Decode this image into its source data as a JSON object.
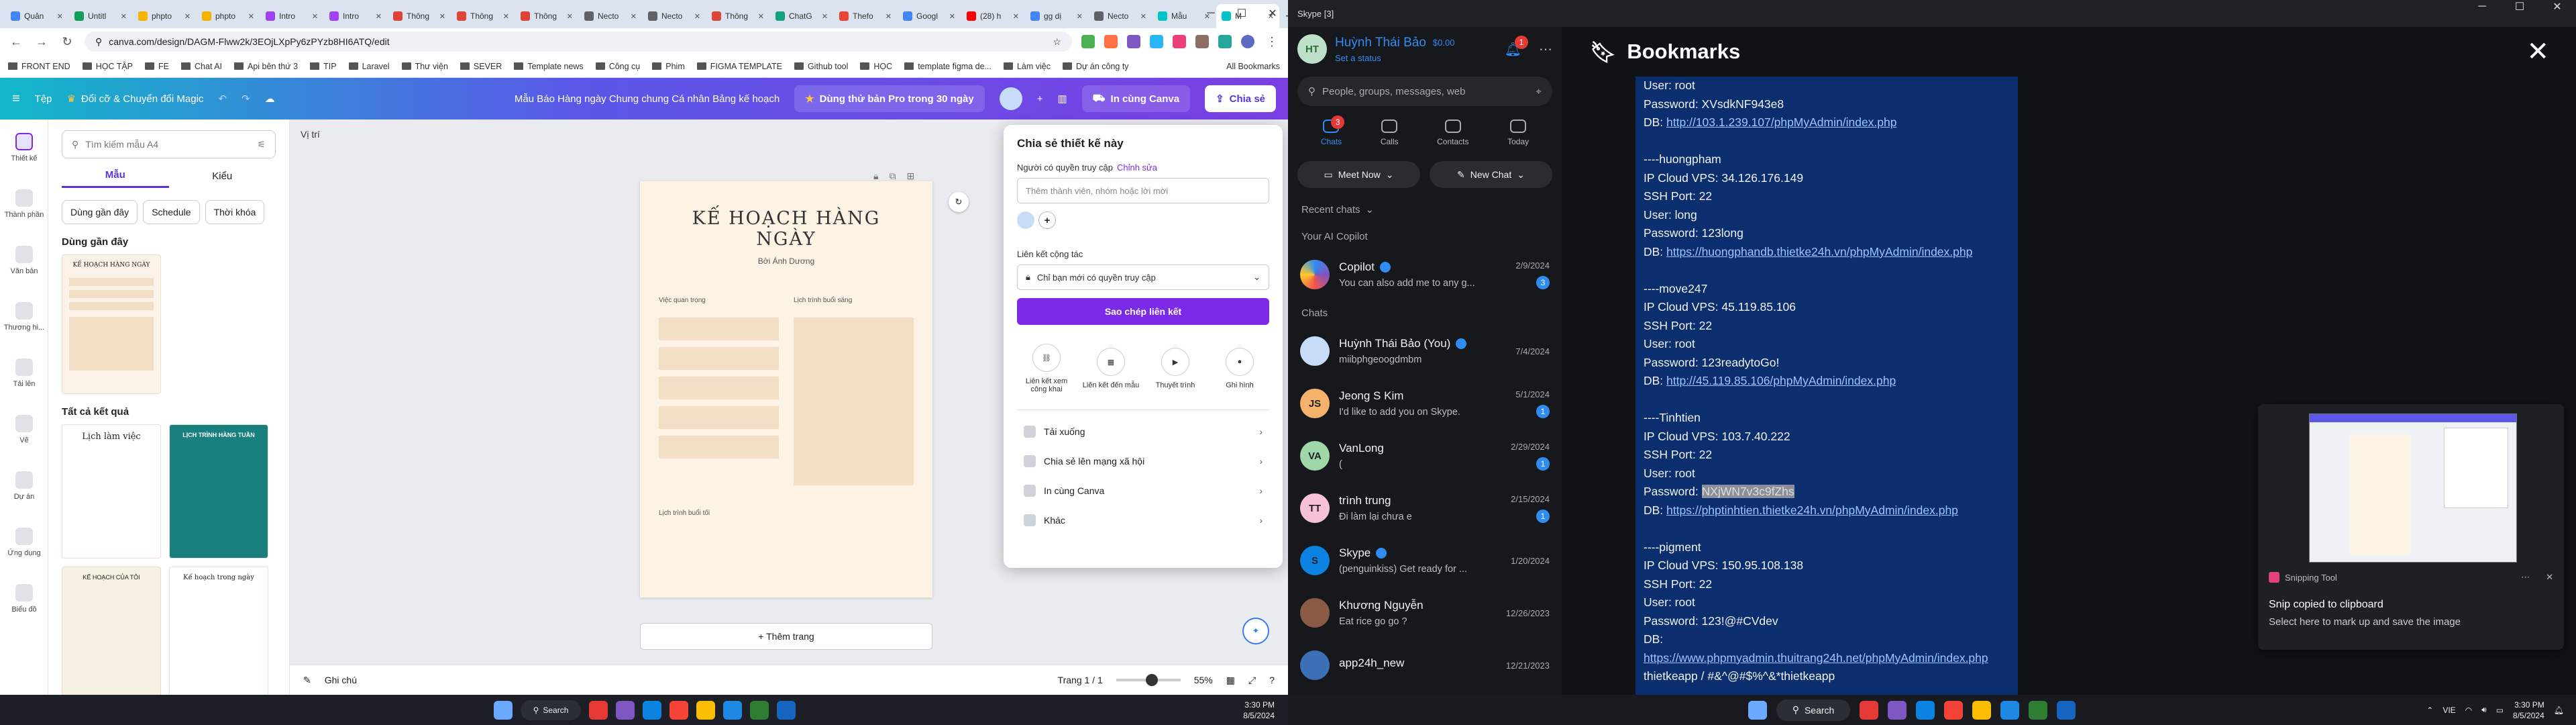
{
  "chrome": {
    "tabs": [
      {
        "label": "Quản",
        "color": "#4285f4"
      },
      {
        "label": "Untitl",
        "color": "#0f9d58"
      },
      {
        "label": "phpto",
        "color": "#f4b400"
      },
      {
        "label": "phpto",
        "color": "#f4b400"
      },
      {
        "label": "Intro",
        "color": "#a142f4"
      },
      {
        "label": "Intro",
        "color": "#a142f4"
      },
      {
        "label": "Thông",
        "color": "#db4437"
      },
      {
        "label": "Thông",
        "color": "#db4437"
      },
      {
        "label": "Thông",
        "color": "#db4437"
      },
      {
        "label": "Necto",
        "color": "#5f6368"
      },
      {
        "label": "Necto",
        "color": "#5f6368"
      },
      {
        "label": "Thông",
        "color": "#db4437"
      },
      {
        "label": "ChatG",
        "color": "#10a37f"
      },
      {
        "label": "Thefo",
        "color": "#ea4335"
      },
      {
        "label": "Googl",
        "color": "#4285f4"
      },
      {
        "label": "(28) h",
        "color": "#ff0000"
      },
      {
        "label": "gg dị",
        "color": "#4285f4"
      },
      {
        "label": "Necto",
        "color": "#5f6368"
      },
      {
        "label": "Mẫu",
        "color": "#00c4cc"
      },
      {
        "label": "M",
        "color": "#00c4cc",
        "active": true
      }
    ],
    "url": "canva.com/design/DAGM-Flww2k/3EOjLXpPy6zPYzb8HI6ATQ/edit",
    "bookmarks": [
      "FRONT END",
      "HỌC TẬP",
      "FE",
      "Chat AI",
      "Api bên thứ 3",
      "TIP",
      "Laravel",
      "Thư viện",
      "SEVER",
      "Template news",
      "Công cụ",
      "Phim",
      "FIGMA TEMPLATE",
      "Github tool",
      "HỌC",
      "template figma de...",
      "Làm việc",
      "Dự án công ty"
    ],
    "all_bookmarks": "All Bookmarks"
  },
  "canva": {
    "menu_file": "Tệp",
    "resize": "Đổi cỡ & Chuyển đổi Magic",
    "doc_title": "Mẫu Báo Hàng ngày Chung chung Cá nhân Bảng kế hoạch",
    "pro_trial": "Dùng thử bản Pro trong 30 ngày",
    "print": "In cùng Canva",
    "share": "Chia sẻ",
    "sidebar": [
      "Thiết kế",
      "Thành phần",
      "Văn bản",
      "Thương hi...",
      "Tải lên",
      "Vẽ",
      "Dự án",
      "Ứng dụng",
      "Biểu đồ"
    ],
    "search_placeholder": "Tìm kiếm mẫu A4",
    "tab_templates": "Mẫu",
    "tab_styles": "Kiểu",
    "chips": [
      "Dùng gần đây",
      "Schedule",
      "Thời khóa"
    ],
    "recent_heading": "Dùng gần đây",
    "all_results": "Tất cả kết quả",
    "thumb_titles": [
      "Lịch làm việc",
      "LỊCH TRÌNH HÀNG TUẦN",
      "KẾ HOẠCH CỦA TÔI",
      "Kế hoạch trong ngày"
    ],
    "position": "Vị trí",
    "page_title": "KẾ HOẠCH HÀNG NGÀY",
    "page_author": "Bởi Ánh Dương",
    "col_tasks": "Việc quan trọng",
    "col_morning": "Lịch trình buổi sáng",
    "col_evening": "Lịch trình buổi tối",
    "add_page": "+ Thêm trang",
    "notes": "Ghi chú",
    "page_count": "Trang 1 / 1",
    "zoom": "55%",
    "zoom_level": 0.55
  },
  "share_panel": {
    "title": "Chia sẻ thiết kế này",
    "access_label": "Người có quyền truy cập",
    "edit_link": "Chỉnh sửa",
    "invite_placeholder": "Thêm thành viên, nhóm hoặc lời mời",
    "collab_label": "Liên kết cộng tác",
    "access_option": "Chỉ bạn mới có quyền truy cập",
    "copy_link": "Sao chép liên kết",
    "icons": [
      "Liên kết xem công khai",
      "Liên kết đến mẫu",
      "Thuyết trình",
      "Ghi hình"
    ],
    "rows": [
      "Tải xuống",
      "Chia sẻ lên mạng xã hội",
      "In cùng Canva",
      "Khác"
    ]
  },
  "skype": {
    "window_title": "Skype [3]",
    "user": "Huỳnh Thái Bảo",
    "initials": "HT",
    "balance": "$0.00",
    "status": "Set a status",
    "notif": "1",
    "search_placeholder": "People, groups, messages, web",
    "nav": [
      {
        "label": "Chats",
        "badge": "3"
      },
      {
        "label": "Calls"
      },
      {
        "label": "Contacts"
      },
      {
        "label": "Today"
      }
    ],
    "meet_now": "Meet Now",
    "new_chat": "New Chat",
    "recent": "Recent chats",
    "copilot_heading": "Your AI Copilot",
    "chats_heading": "Chats",
    "copilot": {
      "name": "Copilot",
      "msg": "You can also add me to any g...",
      "date": "2/9/2024",
      "badge": "3"
    },
    "chats": [
      {
        "name": "Huỳnh Thái Bảo (You)",
        "msg": "miibphgeoogdmbm",
        "date": "7/4/2024",
        "initials": "",
        "color": "#c7ddf7",
        "verified": true
      },
      {
        "name": "Jeong S Kim",
        "msg": "I'd like to add you on Skype.",
        "date": "5/1/2024",
        "initials": "JS",
        "color": "#f4b26b",
        "badge": "1"
      },
      {
        "name": "VanLong",
        "msg": "(",
        "date": "2/29/2024",
        "initials": "VA",
        "color": "#9fd7a9",
        "badge": "1"
      },
      {
        "name": "trình trung",
        "msg": "Đi làm lại chưa e",
        "date": "2/15/2024",
        "initials": "TT",
        "color": "#f7c1d9",
        "badge": "1"
      },
      {
        "name": "Skype",
        "msg": "(penguinkiss) Get ready for ...",
        "date": "1/20/2024",
        "initials": "S",
        "color": "#0a84e0",
        "verified": true
      },
      {
        "name": "Khương Nguyễn",
        "msg": "Eat rice go go ?",
        "date": "12/26/2023",
        "initials": "",
        "color": "#8a5a44"
      },
      {
        "name": "app24h_new",
        "msg": "",
        "date": "12/21/2023",
        "initials": "",
        "color": "#3b6fb6"
      }
    ],
    "bookmarks_title": "Bookmarks",
    "doc_lines": [
      {
        "t": "User: root"
      },
      {
        "t": "Password: XVsdkNF943e8"
      },
      {
        "t": "DB: ",
        "link": "http://103.1.239.107/phpMyAdmin/index.php"
      },
      {
        "t": ""
      },
      {
        "t": "----huongpham"
      },
      {
        "t": "IP Cloud VPS: 34.126.176.149"
      },
      {
        "t": "SSH Port: 22"
      },
      {
        "t": "User: long"
      },
      {
        "t": "Password: 123long"
      },
      {
        "t": "DB: ",
        "link": "https://huongphandb.thietke24h.vn/phpMyAdmin/index.php"
      },
      {
        "t": ""
      },
      {
        "t": "----move247"
      },
      {
        "t": "IP Cloud VPS: 45.119.85.106"
      },
      {
        "t": "SSH Port: 22"
      },
      {
        "t": "User: root"
      },
      {
        "t": "Password: 123readytoGo!"
      },
      {
        "t": "DB: ",
        "link": "http://45.119.85.106/phpMyAdmin/index.php"
      },
      {
        "t": ""
      },
      {
        "t": "----Tinhtien"
      },
      {
        "t": "IP Cloud VPS: 103.7.40.222"
      },
      {
        "t": "SSH Port: 22"
      },
      {
        "t": "User: root"
      },
      {
        "t": "Password: ",
        "hl": "NXjWN7v3c9fZhs"
      },
      {
        "t": "DB: ",
        "link": "https://phptinhtien.thietke24h.vn/phpMyAdmin/index.php"
      },
      {
        "t": ""
      },
      {
        "t": "----pigment"
      },
      {
        "t": "IP Cloud VPS: 150.95.108.138"
      },
      {
        "t": "SSH Port: 22"
      },
      {
        "t": "User: root"
      },
      {
        "t": "Password: 123!@#CVdev"
      },
      {
        "t": "DB: ",
        "link": "https://www.phpmyadmin.thuitrang24h.net/phpMyAdmin/index.php"
      },
      {
        "t": "thietkeapp / #&^@#$%^&*thietkeapp"
      }
    ]
  },
  "snipping": {
    "app": "Snipping Tool",
    "title": "Snip copied to clipboard",
    "sub": "Select here to mark up and save the image"
  },
  "taskbar": {
    "search": "Search",
    "lang": "VIE",
    "time": "3:30 PM",
    "date": "8/5/2024"
  }
}
